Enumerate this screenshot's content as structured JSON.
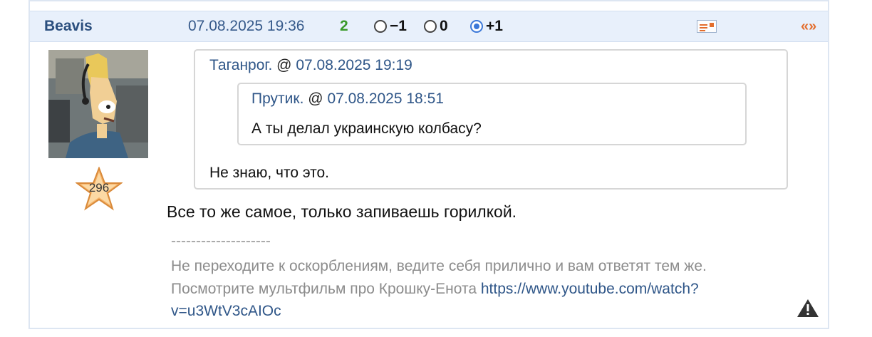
{
  "post": {
    "author": "Beavis",
    "datetime": "07.08.2025 19:36",
    "score": "2",
    "votes": [
      {
        "label": "−1",
        "selected": false
      },
      {
        "label": "0",
        "selected": false
      },
      {
        "label": "+1",
        "selected": true
      }
    ],
    "quote_button": "«»",
    "rating": "296",
    "quote_outer": {
      "author": "Таганрог.",
      "at": "@",
      "datetime": "07.08.2025 19:19",
      "text": "Не знаю, что это."
    },
    "quote_inner": {
      "author": "Прутик.",
      "at": "@",
      "datetime": "07.08.2025 18:51",
      "text": "А ты делал украинскую колбасу?"
    },
    "body": "Все то же самое, только запиваешь горилкой.",
    "signature": {
      "divider": "--------------------",
      "line1": "Не переходите к оскорблениям, ведите себя прилично и вам ответят тем же.",
      "line2": "Посмотрите мультфильм про Крошку-Енота ",
      "link_part1": "https://www.youtube.com/watch?",
      "link_part2": "v=u3WtV3cAIOc"
    }
  },
  "icons": {
    "message": "message-icon",
    "warning": "warning-icon",
    "star": "star-icon",
    "avatar": "avatar-image"
  },
  "colors": {
    "header_bg": "#e8f0fb",
    "author": "#2b4f7e",
    "score": "#3a9a2a",
    "accent": "#e36d2c",
    "link": "#2f5688",
    "radio_selected": "#3b78d8"
  }
}
